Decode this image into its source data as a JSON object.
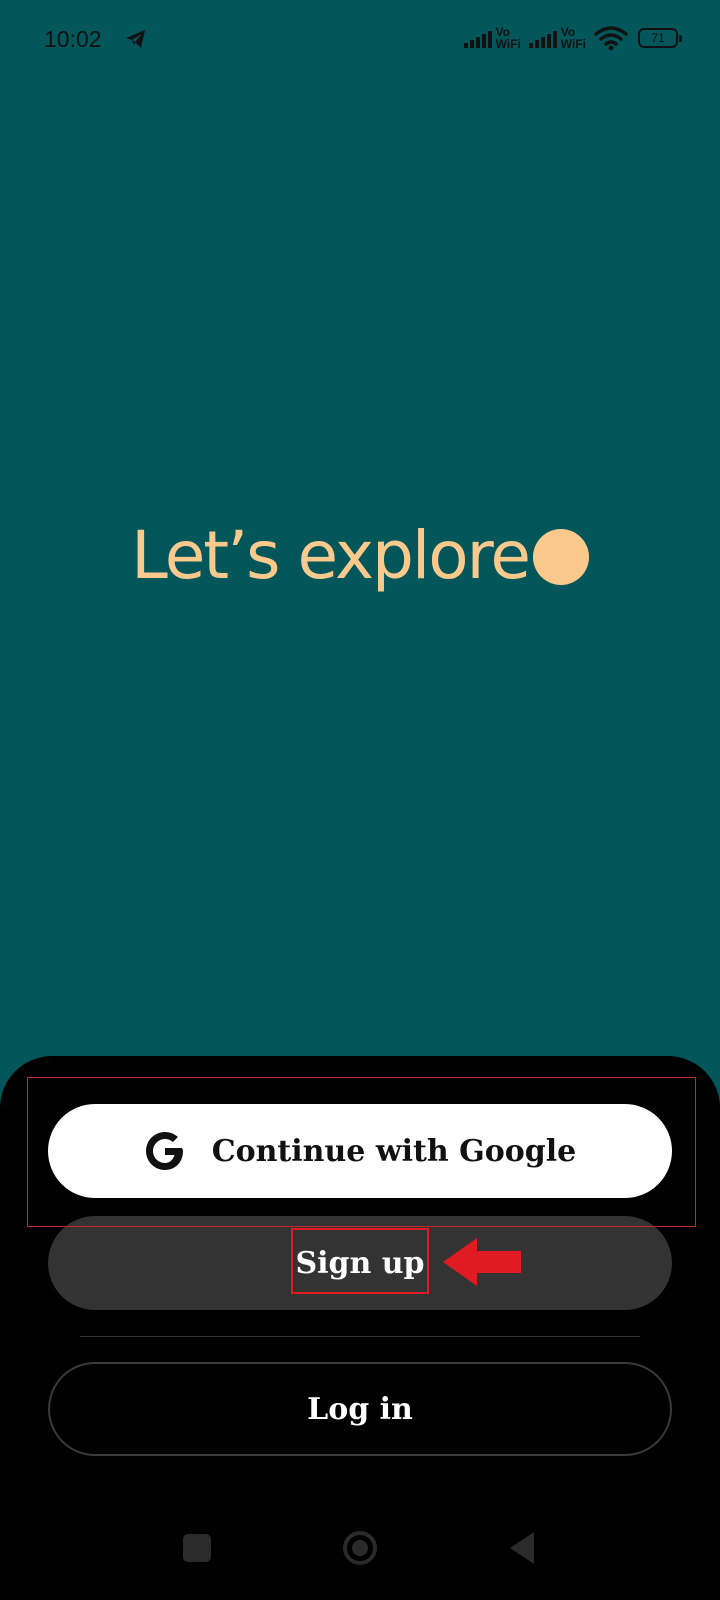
{
  "status_bar": {
    "time": "10:02",
    "network_label_1": "Vo",
    "network_label_2": "WiFi",
    "battery_level": "71"
  },
  "hero": {
    "title": "Let’s explore"
  },
  "auth": {
    "google_label": "Continue with Google",
    "signup_label": "Sign up",
    "login_label": "Log in"
  },
  "colors": {
    "background": "#03565a",
    "accent": "#fbc98c",
    "sheet": "#000000",
    "signup_button": "#333333",
    "annotation": "#e01b24"
  },
  "icons": {
    "status": [
      "telegram-icon",
      "signal-icon",
      "wifi-icon",
      "battery-icon"
    ],
    "google": "google-icon",
    "nav": [
      "recent-apps-icon",
      "home-icon",
      "back-icon"
    ],
    "annotation": "arrow-left-icon"
  }
}
